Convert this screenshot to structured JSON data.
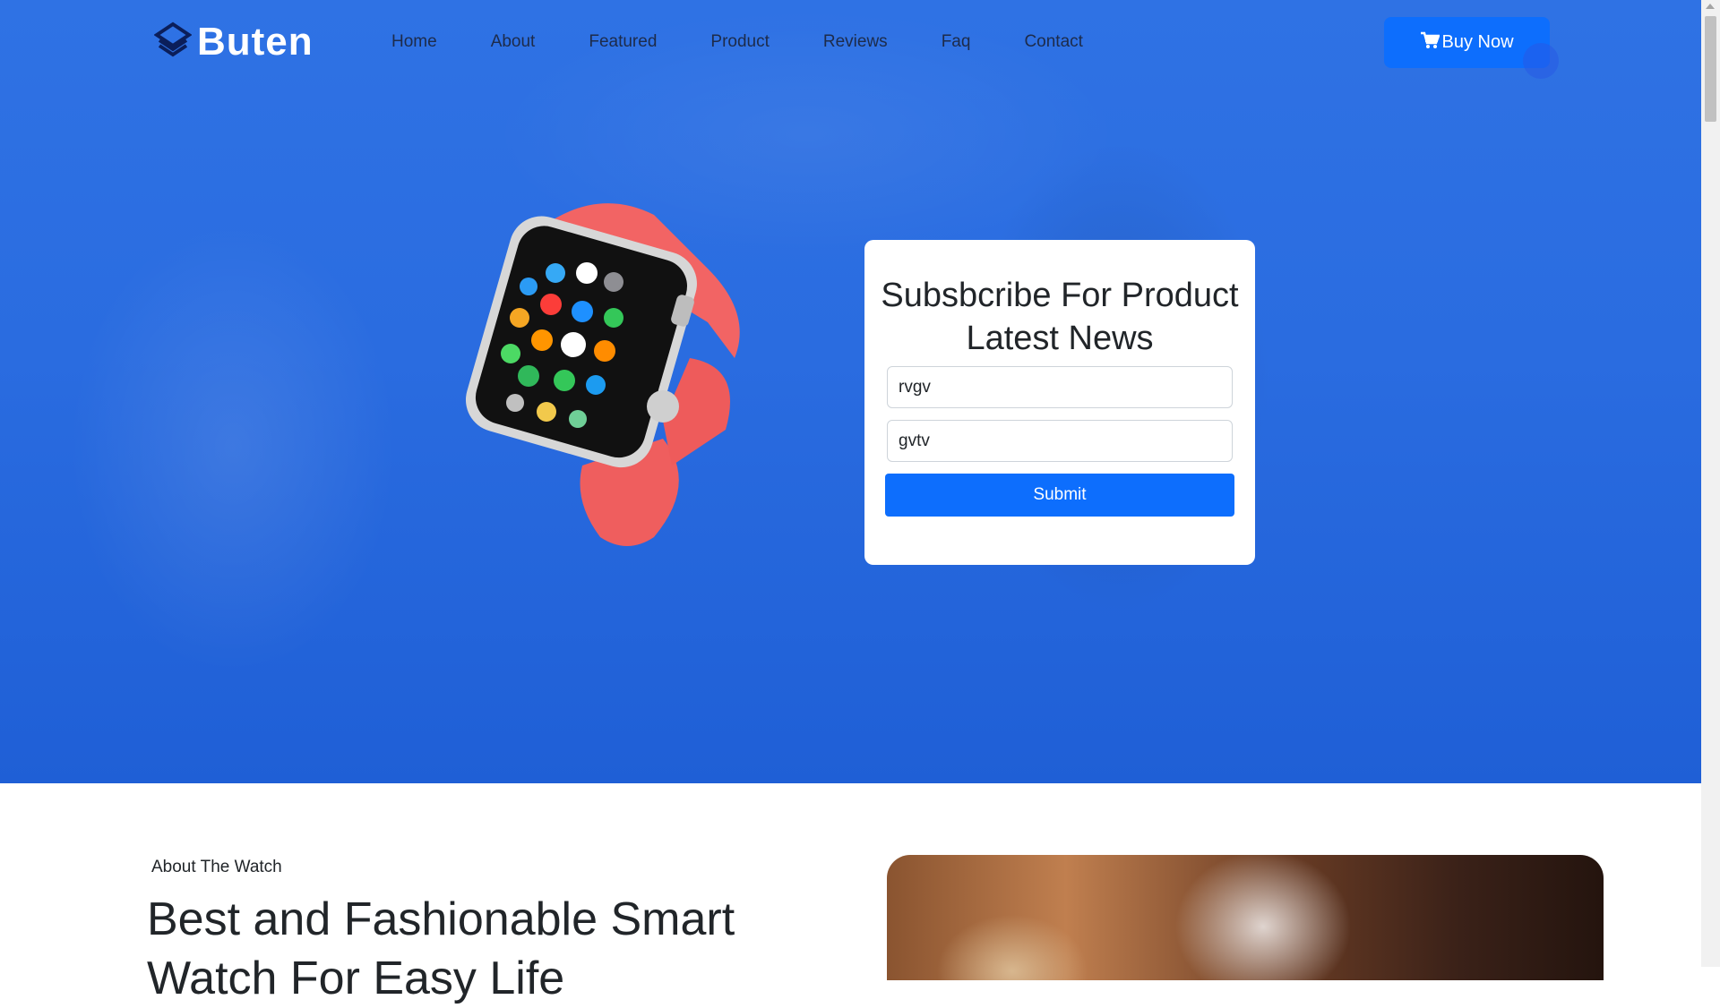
{
  "brand": {
    "name": "Buten",
    "icon": "layers-logo-icon"
  },
  "nav": {
    "items": [
      "Home",
      "About",
      "Featured",
      "Product",
      "Reviews",
      "Faq",
      "Contact"
    ]
  },
  "buy_button": {
    "label": "Buy Now",
    "icon": "cart-icon"
  },
  "subscribe": {
    "title": "Subsbcribe For Product Latest News",
    "field1_value": "rvgv",
    "field2_value": "gvtv",
    "submit_label": "Submit"
  },
  "about": {
    "eyebrow": "About The Watch",
    "headline": "Best and Fashionable Smart Watch For Easy Life"
  },
  "colors": {
    "primary": "#0d6efd",
    "hero_overlay": "#2a6ce0",
    "watch_band": "#f26464"
  }
}
